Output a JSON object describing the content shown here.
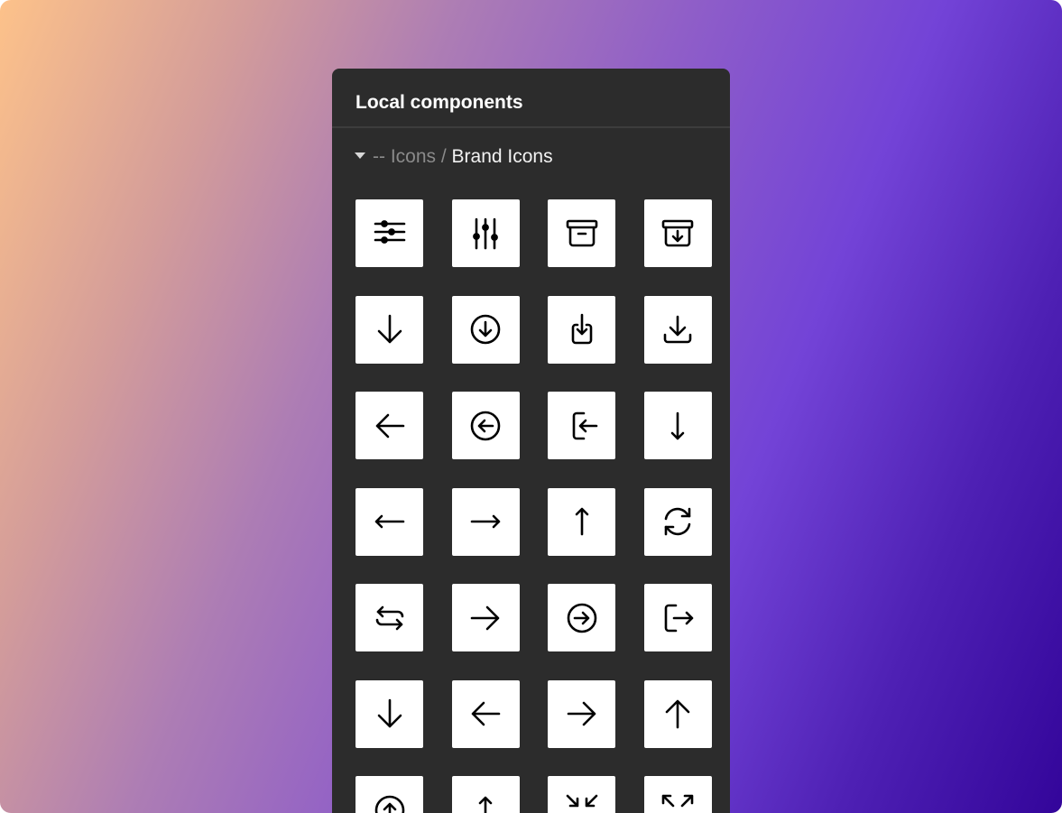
{
  "panel": {
    "title": "Local components"
  },
  "group": {
    "parent_prefix": "-- Icons",
    "separator": " / ",
    "current": "Brand Icons",
    "expanded": true
  },
  "icons": [
    "sliders-horizontal-icon",
    "sliders-vertical-icon",
    "archive-icon",
    "archive-download-icon",
    "arrow-down-icon",
    "arrow-down-circle-icon",
    "download-into-box-icon",
    "download-icon",
    "arrow-left-icon",
    "arrow-left-circle-icon",
    "login-icon",
    "arrow-down-narrow-icon",
    "arrow-left-narrow-icon",
    "arrow-right-narrow-icon",
    "arrow-up-narrow-icon",
    "refresh-icon",
    "repeat-icon",
    "arrow-right-icon",
    "arrow-right-circle-icon",
    "logout-icon",
    "arrow-down-icon",
    "arrow-left-icon",
    "arrow-right-icon",
    "arrow-up-icon",
    "arrow-up-circle-icon",
    "arrow-up-narrow-icon",
    "minimize-icon",
    "maximize-icon"
  ],
  "colors": {
    "panel_bg": "#2c2c2c",
    "tile_bg": "#ffffff",
    "icon_stroke": "#000000",
    "title_text": "#ffffff",
    "muted_text": "#8a8a8a"
  }
}
